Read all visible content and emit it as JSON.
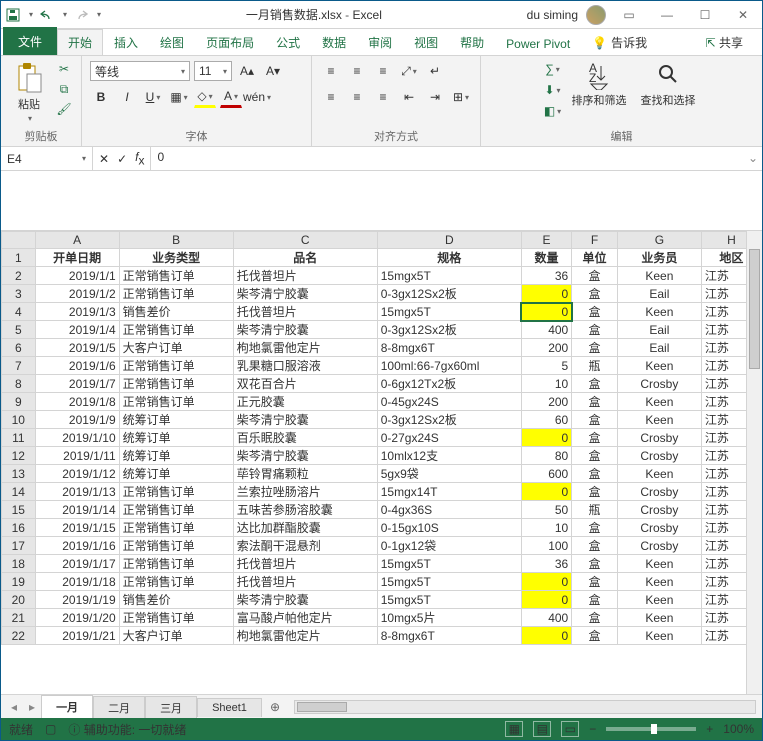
{
  "title": {
    "file": "一月销售数据.xlsx",
    "app": "Excel",
    "user": "du siming"
  },
  "qat": {
    "save": "保存",
    "undo": "撤销",
    "redo": "重做"
  },
  "tabs": {
    "file": "文件",
    "home": "开始",
    "insert": "插入",
    "draw": "绘图",
    "layout": "页面布局",
    "formula": "公式",
    "data": "数据",
    "review": "审阅",
    "view": "视图",
    "help": "帮助",
    "pivot": "Power Pivot",
    "tellme": "告诉我",
    "share": "共享"
  },
  "ribbon": {
    "clipboard": {
      "label": "剪贴板",
      "paste": "粘贴"
    },
    "font": {
      "label": "字体",
      "name": "等线",
      "size": "11"
    },
    "align": {
      "label": "对齐方式"
    },
    "editing": {
      "label": "编辑",
      "sort": "排序和筛选",
      "find": "查找和选择"
    }
  },
  "namebox": "E4",
  "formula": "0",
  "cols": [
    "A",
    "B",
    "C",
    "D",
    "E",
    "F",
    "G",
    "H"
  ],
  "headers": {
    "a": "开单日期",
    "b": "业务类型",
    "c": "品名",
    "d": "规格",
    "e": "数量",
    "f": "单位",
    "g": "业务员",
    "h": "地区"
  },
  "rows": [
    {
      "n": 2,
      "a": "2019/1/1",
      "b": "正常销售订单",
      "c": "托伐普坦片",
      "d": "15mgx5T",
      "e": "36",
      "f": "盒",
      "g": "Keen",
      "h": "江苏"
    },
    {
      "n": 3,
      "a": "2019/1/2",
      "b": "正常销售订单",
      "c": "柴芩清宁胶囊",
      "d": "0-3gx12Sx2板",
      "e": "0",
      "f": "盒",
      "g": "Eail",
      "h": "江苏",
      "hl": true
    },
    {
      "n": 4,
      "a": "2019/1/3",
      "b": "销售差价",
      "c": "托伐普坦片",
      "d": "15mgx5T",
      "e": "0",
      "f": "盒",
      "g": "Keen",
      "h": "江苏",
      "hl": true,
      "sel": true
    },
    {
      "n": 5,
      "a": "2019/1/4",
      "b": "正常销售订单",
      "c": "柴芩清宁胶囊",
      "d": "0-3gx12Sx2板",
      "e": "400",
      "f": "盒",
      "g": "Eail",
      "h": "江苏"
    },
    {
      "n": 6,
      "a": "2019/1/5",
      "b": "大客户订单",
      "c": "枸地氯雷他定片",
      "d": "8-8mgx6T",
      "e": "200",
      "f": "盒",
      "g": "Eail",
      "h": "江苏"
    },
    {
      "n": 7,
      "a": "2019/1/6",
      "b": "正常销售订单",
      "c": "乳果糖口服溶液",
      "d": "100ml:66-7gx60ml",
      "e": "5",
      "f": "瓶",
      "g": "Keen",
      "h": "江苏"
    },
    {
      "n": 8,
      "a": "2019/1/7",
      "b": "正常销售订单",
      "c": "双花百合片",
      "d": "0-6gx12Tx2板",
      "e": "10",
      "f": "盒",
      "g": "Crosby",
      "h": "江苏"
    },
    {
      "n": 9,
      "a": "2019/1/8",
      "b": "正常销售订单",
      "c": "正元胶囊",
      "d": "0-45gx24S",
      "e": "200",
      "f": "盒",
      "g": "Keen",
      "h": "江苏"
    },
    {
      "n": 10,
      "a": "2019/1/9",
      "b": "统筹订单",
      "c": "柴芩清宁胶囊",
      "d": "0-3gx12Sx2板",
      "e": "60",
      "f": "盒",
      "g": "Keen",
      "h": "江苏"
    },
    {
      "n": 11,
      "a": "2019/1/10",
      "b": "统筹订单",
      "c": "百乐眠胶囊",
      "d": "0-27gx24S",
      "e": "0",
      "f": "盒",
      "g": "Crosby",
      "h": "江苏",
      "hl": true
    },
    {
      "n": 12,
      "a": "2019/1/11",
      "b": "统筹订单",
      "c": "柴芩清宁胶囊",
      "d": "10mlx12支",
      "e": "80",
      "f": "盒",
      "g": "Crosby",
      "h": "江苏"
    },
    {
      "n": 13,
      "a": "2019/1/12",
      "b": "统筹订单",
      "c": "荜铃胃痛颗粒",
      "d": "5gx9袋",
      "e": "600",
      "f": "盒",
      "g": "Keen",
      "h": "江苏"
    },
    {
      "n": 14,
      "a": "2019/1/13",
      "b": "正常销售订单",
      "c": "兰索拉唑肠溶片",
      "d": "15mgx14T",
      "e": "0",
      "f": "盒",
      "g": "Crosby",
      "h": "江苏",
      "hl": true
    },
    {
      "n": 15,
      "a": "2019/1/14",
      "b": "正常销售订单",
      "c": "五味苦参肠溶胶囊",
      "d": "0-4gx36S",
      "e": "50",
      "f": "瓶",
      "g": "Crosby",
      "h": "江苏"
    },
    {
      "n": 16,
      "a": "2019/1/15",
      "b": "正常销售订单",
      "c": "达比加群酯胶囊",
      "d": "0-15gx10S",
      "e": "10",
      "f": "盒",
      "g": "Crosby",
      "h": "江苏"
    },
    {
      "n": 17,
      "a": "2019/1/16",
      "b": "正常销售订单",
      "c": "索法酮干混悬剂",
      "d": "0-1gx12袋",
      "e": "100",
      "f": "盒",
      "g": "Crosby",
      "h": "江苏"
    },
    {
      "n": 18,
      "a": "2019/1/17",
      "b": "正常销售订单",
      "c": "托伐普坦片",
      "d": "15mgx5T",
      "e": "36",
      "f": "盒",
      "g": "Keen",
      "h": "江苏"
    },
    {
      "n": 19,
      "a": "2019/1/18",
      "b": "正常销售订单",
      "c": "托伐普坦片",
      "d": "15mgx5T",
      "e": "0",
      "f": "盒",
      "g": "Keen",
      "h": "江苏",
      "hl": true
    },
    {
      "n": 20,
      "a": "2019/1/19",
      "b": "销售差价",
      "c": "柴芩清宁胶囊",
      "d": "15mgx5T",
      "e": "0",
      "f": "盒",
      "g": "Keen",
      "h": "江苏",
      "hl": true
    },
    {
      "n": 21,
      "a": "2019/1/20",
      "b": "正常销售订单",
      "c": "富马酸卢帕他定片",
      "d": "10mgx5片",
      "e": "400",
      "f": "盒",
      "g": "Keen",
      "h": "江苏"
    },
    {
      "n": 22,
      "a": "2019/1/21",
      "b": "大客户订单",
      "c": "枸地氯雷他定片",
      "d": "8-8mgx6T",
      "e": "0",
      "f": "盒",
      "g": "Keen",
      "h": "江苏",
      "hl": true
    }
  ],
  "sheets": {
    "s1": "一月",
    "s2": "二月",
    "s3": "三月",
    "s4": "Sheet1"
  },
  "status": {
    "ready": "就绪",
    "access": "辅助功能: 一切就绪",
    "zoom": "100%"
  }
}
